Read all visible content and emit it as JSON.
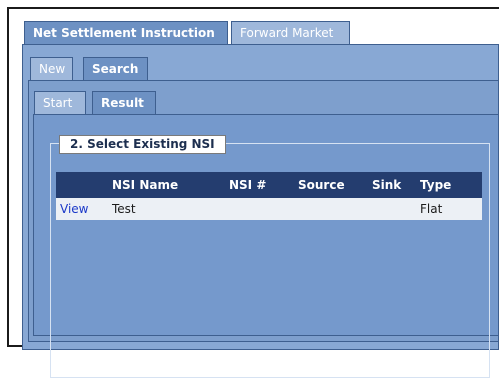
{
  "tabs_level1": [
    {
      "label": "Net Settlement Instruction",
      "active": true
    },
    {
      "label": "Forward Market",
      "active": false
    }
  ],
  "tabs_level2": [
    {
      "label": "New",
      "active": false
    },
    {
      "label": "Search",
      "active": true
    }
  ],
  "tabs_level3": [
    {
      "label": "Start",
      "active": false
    },
    {
      "label": "Result",
      "active": true
    }
  ],
  "section": {
    "legend": "2. Select Existing NSI"
  },
  "table": {
    "columns": [
      "",
      "NSI Name",
      "NSI #",
      "Source",
      "Sink",
      "Type"
    ],
    "rows": [
      {
        "action": "View",
        "nsi_name": "Test",
        "nsi_num": "",
        "source": "",
        "sink": "",
        "type": "Flat"
      }
    ]
  },
  "colors": {
    "tab_active": "#6d91c3",
    "tab_inactive": "#9fb8db",
    "panel": "#88a8d4",
    "table_header": "#243d6f",
    "table_row": "#ecf0f5",
    "link": "#1a38c8"
  }
}
